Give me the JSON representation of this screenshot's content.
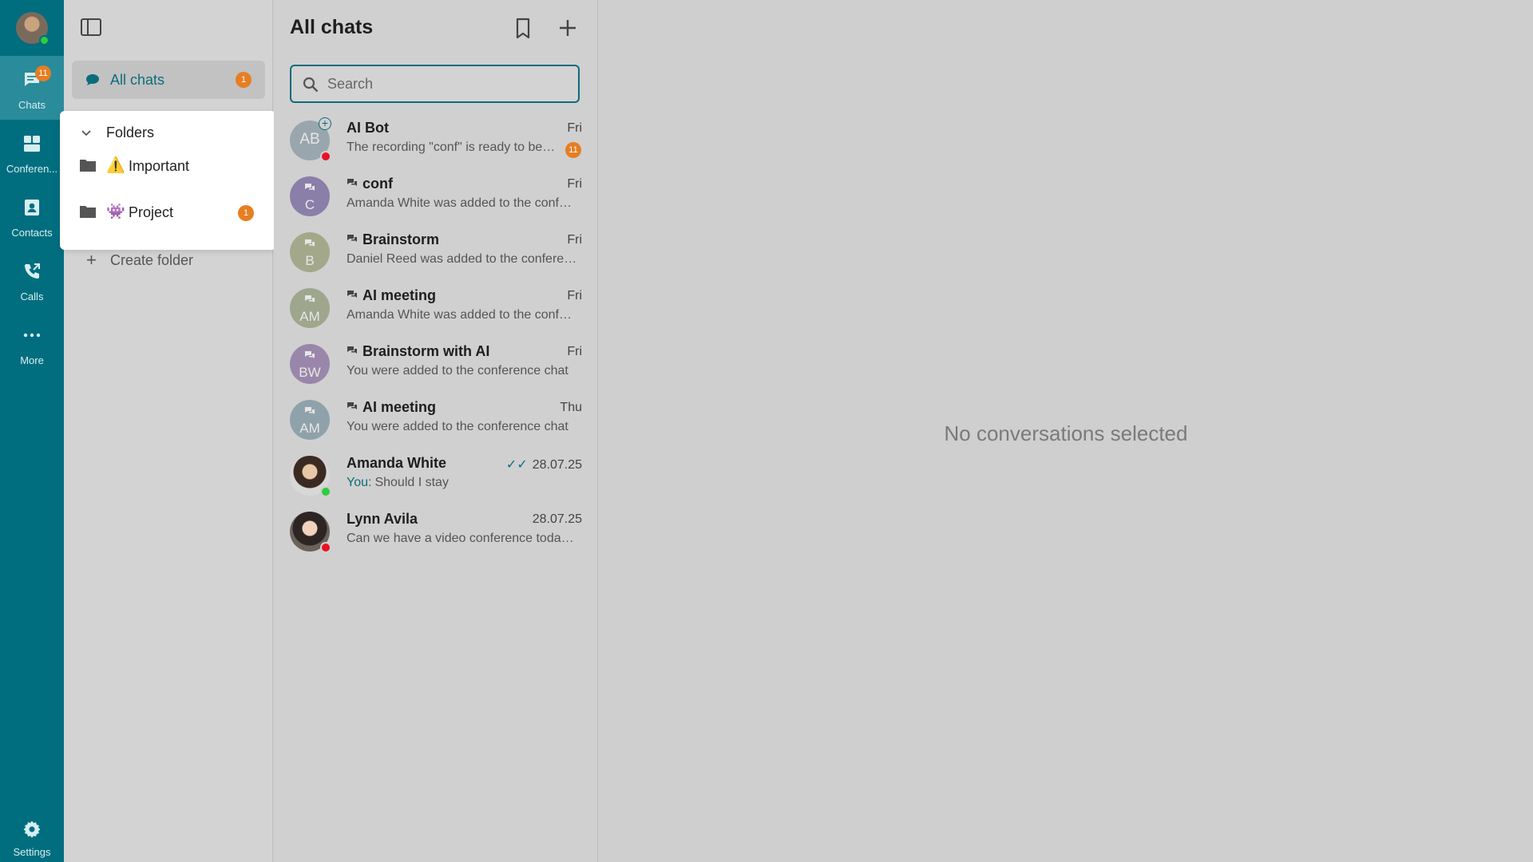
{
  "rail": {
    "items": [
      {
        "label": "Chats",
        "badge": "11",
        "icon": "chat-icon"
      },
      {
        "label": "Conferen...",
        "icon": "conference-icon"
      },
      {
        "label": "Contacts",
        "icon": "contacts-icon"
      },
      {
        "label": "Calls",
        "icon": "calls-icon"
      },
      {
        "label": "More",
        "icon": "more-icon"
      }
    ],
    "settings_label": "Settings"
  },
  "folders": {
    "all_chats_label": "All chats",
    "all_chats_badge": "1",
    "header": "Folders",
    "items": [
      {
        "emoji": "⚠️",
        "label": "Important"
      },
      {
        "emoji": "👾",
        "label": "Project",
        "badge": "1"
      }
    ],
    "create_label": "Create folder"
  },
  "chatlist": {
    "title": "All chats",
    "search_placeholder": "Search",
    "chats": [
      {
        "title": "AI Bot",
        "initials": "AB",
        "time": "Fri",
        "preview": "The recording \"conf\" is ready to be t...",
        "unread": "11",
        "color": "#9aa6ad"
      },
      {
        "title": "conf",
        "initials": "C",
        "time": "Fri",
        "preview": "Amanda White was added to the confer...",
        "color": "#8a7fa8"
      },
      {
        "title": "Brainstorm",
        "initials": "B",
        "time": "Fri",
        "preview": "Daniel Reed was added to the conferen...",
        "color": "#a3a88a"
      },
      {
        "title": "AI meeting",
        "initials": "AM",
        "time": "Fri",
        "preview": "Amanda White was added to the confer...",
        "color": "#9fa68e"
      },
      {
        "title": "Brainstorm with AI",
        "initials": "BW",
        "time": "Fri",
        "preview": "You were added to the conference chat",
        "color": "#9a86aa"
      },
      {
        "title": "AI meeting",
        "initials": "AM",
        "time": "Thu",
        "preview": "You were added to the conference chat",
        "color": "#8fa2ab"
      },
      {
        "title": "Amanda White",
        "time": "28.07.25",
        "preview_prefix": "You:",
        "preview": "Should I stay"
      },
      {
        "title": "Lynn Avila",
        "time": "28.07.25",
        "preview": "Can we have a video conference today ..."
      }
    ]
  },
  "main": {
    "empty_text": "No conversations selected"
  },
  "colors": {
    "rail": "#006e7f",
    "accent": "#0d6c7c",
    "badge": "#e67e22",
    "online": "#2ecc40",
    "busy": "#e81123"
  }
}
